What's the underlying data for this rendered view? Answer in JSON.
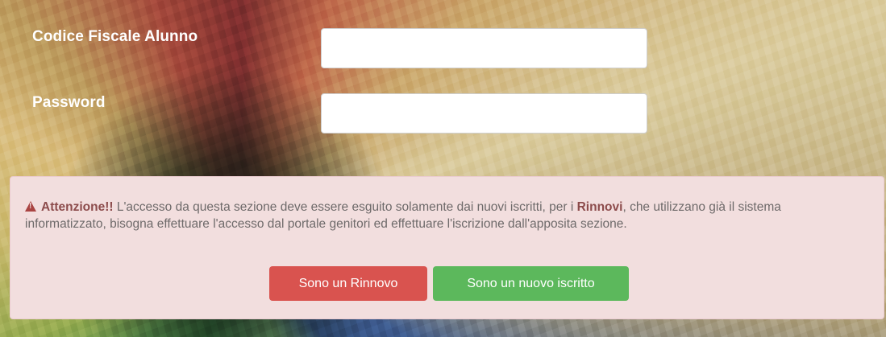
{
  "form": {
    "codice_label": "Codice Fiscale Alunno",
    "codice_value": "",
    "password_label": "Password",
    "password_value": ""
  },
  "alert": {
    "icon": "warning-triangle-icon",
    "title": "Attenzione!!",
    "text_part1": " L'accesso da questa sezione deve essere esguito solamente dai nuovi iscritti, per i ",
    "highlight": "Rinnovi",
    "text_part2": ", che utilizzano già il sistema informatizzato, bisogna effettuare l'accesso dal portale genitori ed effettuare l'iscrizione dall'apposita sezione.",
    "renew_button": "Sono un Rinnovo",
    "new_button": "Sono un nuovo iscritto"
  },
  "colors": {
    "alert_bg": "#f2dede",
    "renew": "#d9534f",
    "new": "#5cb85c"
  }
}
